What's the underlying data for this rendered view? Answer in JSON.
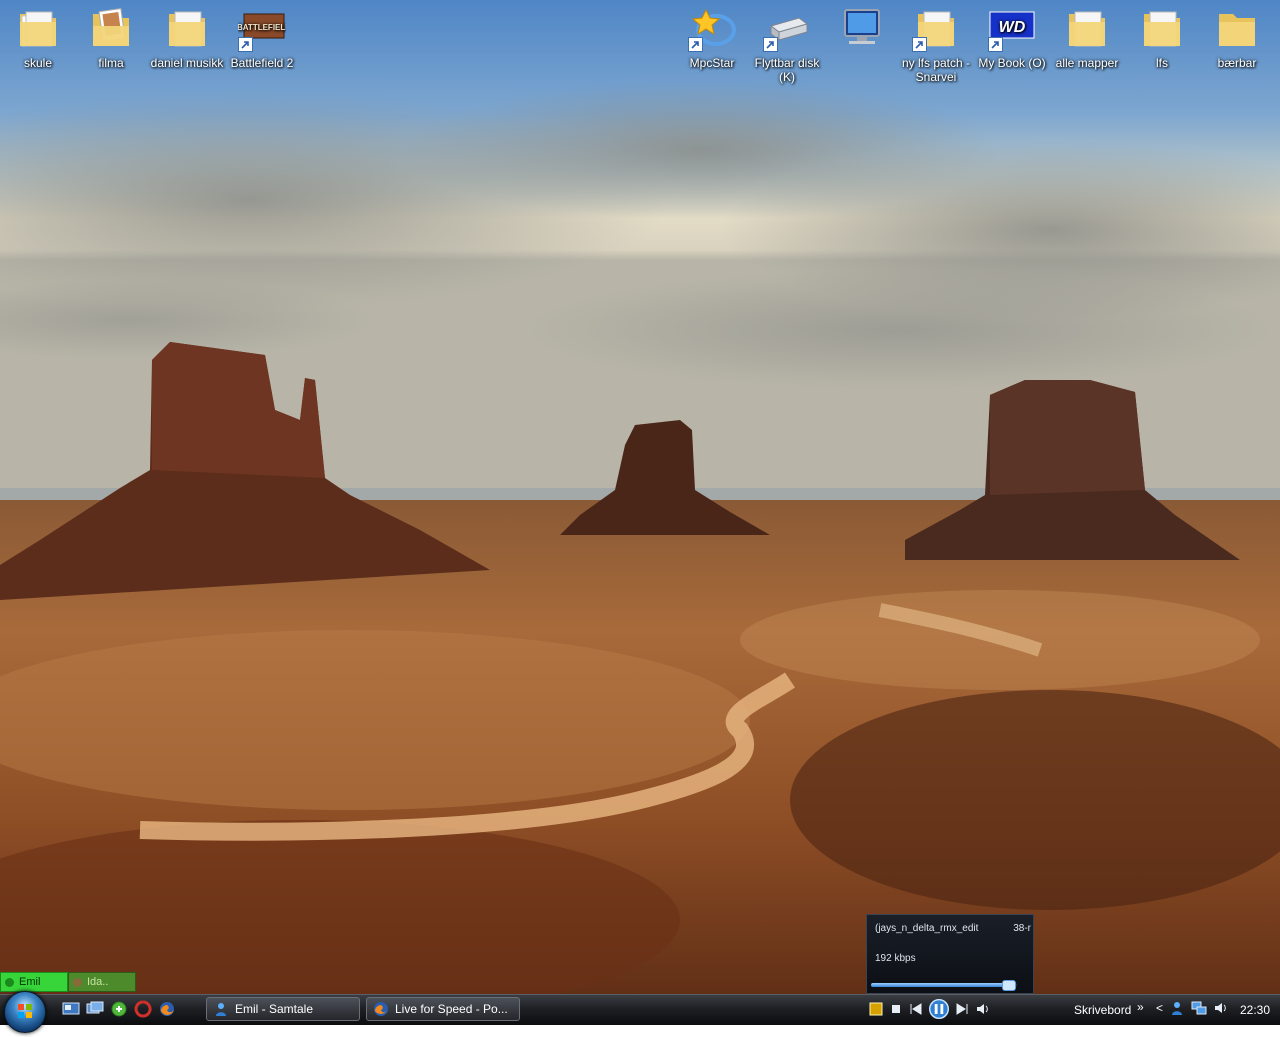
{
  "desktop_icons": [
    {
      "label": "skule"
    },
    {
      "label": "filma"
    },
    {
      "label": "daniel musikk"
    },
    {
      "label": "Battlefield 2"
    },
    {
      "label": "MpcStar"
    },
    {
      "label": "Flyttbar disk (K)"
    },
    {
      "label": ""
    },
    {
      "label": "ny lfs patch - Snarvei"
    },
    {
      "label": "My Book (O)"
    },
    {
      "label": "alle mapper"
    },
    {
      "label": "lfs"
    },
    {
      "label": "bærbar"
    }
  ],
  "battlefield_logo_text": "BATTLEFIELD",
  "wd_logo_text": "WD",
  "contacts": [
    {
      "name": "Emil",
      "status": "online"
    },
    {
      "name": "Ida..",
      "status": "away"
    }
  ],
  "player": {
    "track_title": "(jays_n_delta_rmx_edit",
    "track_number": "38-r",
    "bitrate": "192 kbps",
    "progress": 0.95
  },
  "taskbar": {
    "buttons": [
      {
        "label": "Emil - Samtale"
      },
      {
        "label": "Live for Speed - Po..."
      }
    ],
    "desktop_toolbar_label": "Skrivebord",
    "overflow_chevron": "»",
    "tray_arrow": "<",
    "clock": "22:30"
  },
  "colors": {
    "taskbar": "#1e2024",
    "folder": "#f3d57a",
    "online": "#37d43a",
    "accent": "#3d86c8"
  }
}
